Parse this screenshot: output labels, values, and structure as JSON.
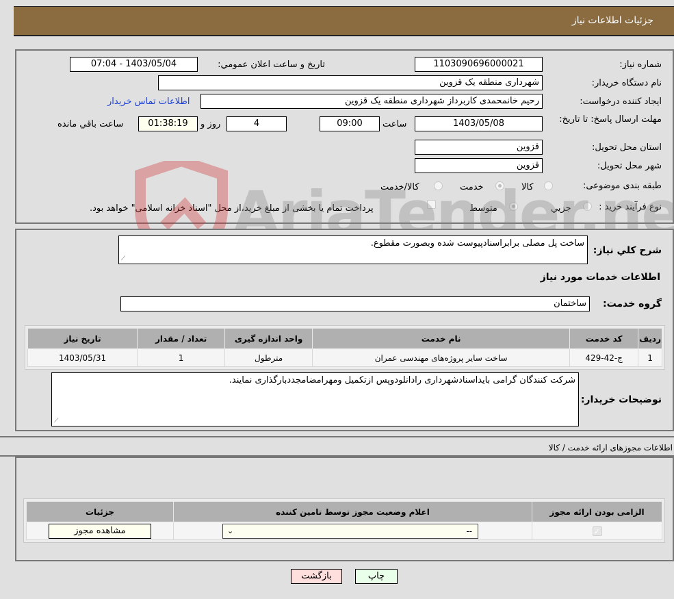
{
  "header": {
    "title": "جزئیات اطلاعات نیاز"
  },
  "need_info": {
    "need_number_label": "شماره نیاز:",
    "need_number": "1103090696000021",
    "announce_label": "تاریخ و ساعت اعلان عمومي:",
    "announce_value": "1403/05/04 - 07:04",
    "buyer_org_label": "نام دستگاه خریدار:",
    "buyer_org": "شهرداری منطقه یک قزوین",
    "requester_label": "ایجاد کننده درخواست:",
    "requester": "رحیم خانمحمدی کاربرداز شهرداری منطقه یک قزوین",
    "buyer_contact_link": "اطلاعات تماس خریدار",
    "deadline_label": "مهلت ارسال پاسخ: تا تاریخ:",
    "deadline_date": "1403/05/08",
    "time_label": "ساعت",
    "deadline_time": "09:00",
    "days_value": "4",
    "days_label": "روز و",
    "remaining_time": "01:38:19",
    "remaining_label": "ساعت باقي مانده",
    "province_label": "استان محل تحویل:",
    "province": "قزوین",
    "city_label": "شهر محل تحویل:",
    "city": "قزوین",
    "category_label": "طبقه بندی موضوعی:",
    "category_options": [
      {
        "label": "کالا",
        "checked": false
      },
      {
        "label": "خدمت",
        "checked": true
      },
      {
        "label": "کالا/خدمت",
        "checked": false
      }
    ],
    "purchase_type_label": "نوع فرآیند خرید :",
    "purchase_type_options": [
      {
        "label": "جزيي",
        "checked": false
      },
      {
        "label": "متوسط",
        "checked": true
      }
    ],
    "treasury_note": "پرداخت تمام یا بخشی از مبلغ خرید،از محل \"اسناد خزانه اسلامی\" خواهد بود.",
    "treasury_checked": false
  },
  "description": {
    "label": "شرح کلي نیاز:",
    "text": "ساخت پل مصلی برابراسنادپیوست شده وبصورت مقطوع.",
    "services_heading": "اطلاعات خدمات مورد نیاز",
    "service_group_label": "گروه خدمت:",
    "service_group": "ساختمان"
  },
  "services_table": {
    "columns": [
      "ردیف",
      "کد خدمت",
      "نام خدمت",
      "واحد اندازه گیری",
      "تعداد / مقدار",
      "تاریخ نیاز"
    ],
    "rows": [
      [
        "1",
        "ج-42-429",
        "ساخت سایر پروژه‌های مهندسی عمران",
        "مترطول",
        "1",
        "1403/05/31"
      ]
    ]
  },
  "buyer_notes": {
    "label": "توضیحات خریدار:",
    "text": "شرکت کنندگان گرامی بایداسنادشهرداری رادانلودوپس ازتکمیل ومهرامضامجددبارگذاری نمایند."
  },
  "permits": {
    "title": "اطلاعات مجوزهای ارائه خدمت / کالا",
    "columns": [
      "الزامی بودن ارائه مجوز",
      "اعلام وضعیت مجوز توسط تامین کننده",
      "جزئیات"
    ],
    "row": {
      "required_checked": true,
      "status_value": "--",
      "details_button": "مشاهده مجوز"
    }
  },
  "actions": {
    "print": "چاپ",
    "back": "بازگشت"
  },
  "watermark": {
    "text": "AriaTender.neT"
  },
  "colors": {
    "header_bg": "#8b6b40",
    "link": "#1a3fd8",
    "print_bg": "#eaffea",
    "back_bg": "#ffdede"
  }
}
